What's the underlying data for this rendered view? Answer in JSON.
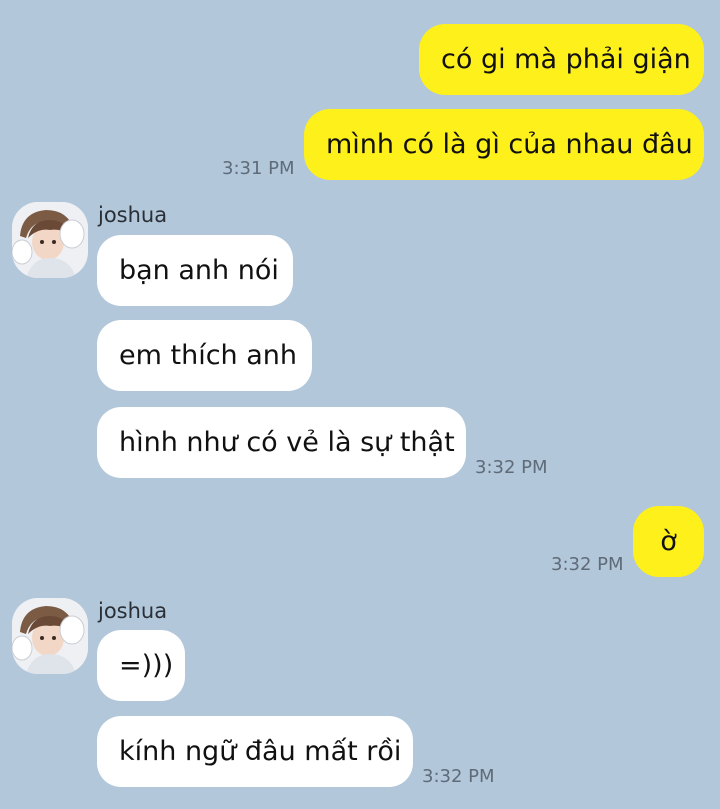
{
  "messages": {
    "m1": "có gi mà phải giận",
    "m2": "mình có là gì của nhau đâu",
    "t1": "3:31 PM",
    "m3": "bạn anh nói",
    "m4": "em thích anh",
    "m5": "hình như có vẻ là sự thật",
    "t2": "3:32 PM",
    "m6": "ờ",
    "t3": "3:32 PM",
    "m7": "=)))",
    "m8": "kính ngữ đâu mất rồi",
    "t4": "3:32 PM"
  },
  "contacts": {
    "sender1": "joshua",
    "sender2": "joshua"
  },
  "colors": {
    "background": "#b2c7da",
    "outgoing_bubble": "#fef01b",
    "incoming_bubble": "#ffffff",
    "timestamp": "#5f6b78"
  },
  "icons": {
    "avatar": "profile-photo"
  }
}
